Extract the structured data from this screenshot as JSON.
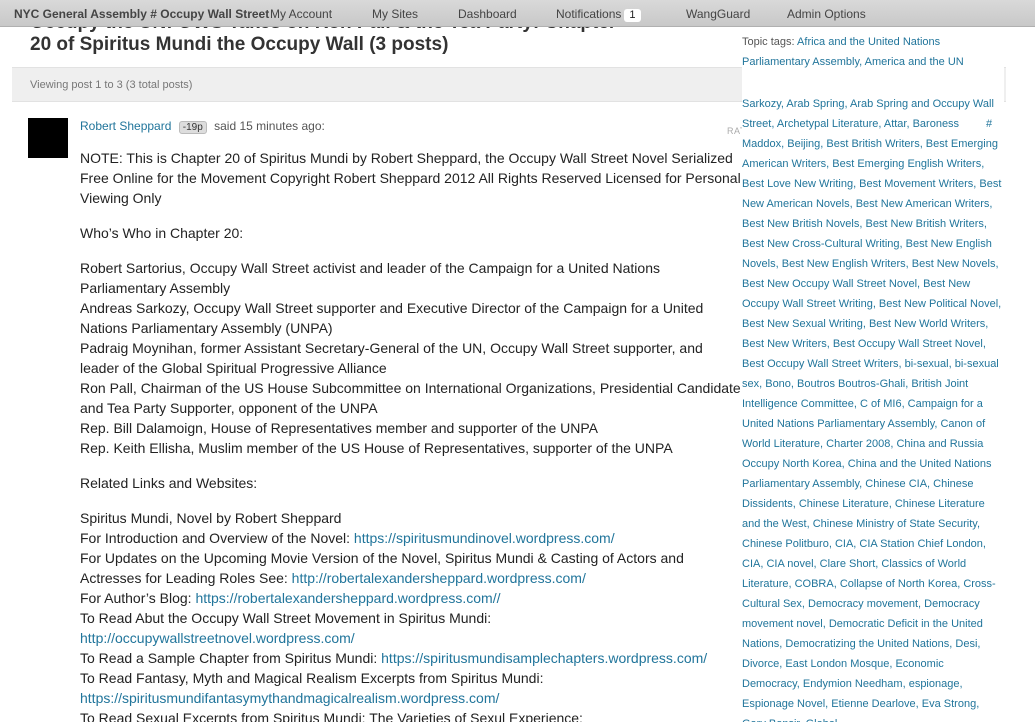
{
  "adminbar": {
    "site": "NYC General Assembly # Occupy Wall Street",
    "my_account": "My Account",
    "my_sites": "My Sites",
    "dashboard": "Dashboard",
    "notifications": "Notifications",
    "notifications_count": "1",
    "wangguard": "WangGuard",
    "admin_options": "Admin Options"
  },
  "topic": {
    "title_line1": "Occupy the UN: OWS Takes on Ron Pall & the Tea Party: Chapter",
    "title_line2": "20 of Spiritus Mundi the Occupy Wall (3 posts)",
    "viewing": "Viewing post 1 to 3 (3 total posts)"
  },
  "post": {
    "author": "Robert Sheppard",
    "karma": "-19p",
    "time": "said 15 minutes ago:",
    "rate_label": "RATE THIS POST",
    "note": "NOTE: This is Chapter 20 of Spiritus Mundi by Robert Sheppard, the Occupy Wall Street Novel Serialized Free Online for the Movement Copyright Robert Sheppard 2012 All Rights Reserved Licensed for Personal Viewing Only",
    "whos_who": "Who’s Who in Chapter 20:",
    "characters": [
      "Robert Sartorius, Occupy Wall Street activist and leader of the Campaign for a United Nations Parliamentary Assembly",
      "Andreas Sarkozy, Occupy Wall Street supporter and Executive Director of the Campaign for a United Nations Parliamentary Assembly (UNPA)",
      "Padraig Moynihan, former Assistant Secretary-General of the UN, Occupy Wall Street supporter, and leader of the Global Spiritual Progressive Alliance",
      "Ron Pall, Chairman of the US House Subcommittee on International Organizations, Presidential Candidate and Tea Party Supporter, opponent of the UNPA",
      "Rep. Bill Dalamoign, House of Representatives member and supporter of the UNPA",
      "Rep. Keith Ellisha, Muslim member of the US House of Representatives, supporter of the UNPA"
    ],
    "related": "Related Links and Websites:",
    "novel_line": "Spiritus Mundi, Novel by Robert Sheppard",
    "intro_text": "For Introduction and Overview of the Novel: ",
    "intro_link": "https://spiritusmundinovel.wordpress.com/",
    "movie_text": "For Updates on the Upcoming Movie Version of the Novel, Spiritus Mundi & Casting of Actors and Actresses for Leading Roles See: ",
    "movie_link": "http://robertalexandersheppard.wordpress.com/",
    "blog_text": "For Author’s Blog: ",
    "blog_link": "https://robertalexandersheppard.wordpress.com//",
    "ows_text": "To Read Abut the Occupy Wall Street Movement in Spiritus Mundi:",
    "ows_link": "http://occupywallstreetnovel.wordpress.com/",
    "sample_text": "To Read a Sample Chapter from Spiritus Mundi: ",
    "sample_link": "https://spiritusmundisamplechapters.wordpress.com/",
    "fantasy_text": "To Read Fantasy, Myth and Magical Realism Excerpts from Spiritus Mundi:",
    "fantasy_link": "https://spiritusmundifantasymythandmagicalrealism.wordpress.com/",
    "sexual_text": "To Read Sexual Excerpts from Spiritus Mundi: The Varieties of Sexul Experience:"
  },
  "sidebar": {
    "topic_tags_label": "Topic tags:",
    "tags_top": "Africa and the United Nations Parliamentary Assembly, America and the UN",
    "tags_main": "Sarkozy, Arab Spring, Arab Spring and Occupy Wall Street, Archetypal Literature, Attar, Baroness Maddox, Beijing, Best British Writers, Best Emerging American Writers, Best Emerging English Writers, Best Love New Writing, Best Movement Writers, Best New American Novels, Best New American Writers, Best New British Novels, Best New British Writers, Best New Cross-Cultural Writing, Best New English Novels, Best New English Writers, Best New Novels, Best New Occupy Wall Street Novel, Best New Occupy Wall Street Writing, Best New Political Novel, Best New Sexual Writing, Best New World Writers, Best New Writers, Best Occupy Wall Street Novel, Best Occupy Wall Street Writers, bi-sexual, bi-sexual sex, Bono, Boutros Boutros-Ghali, British Joint Intelligence Committee, C of MI6, Campaign for a United Nations Parliamentary Assembly, Canon of World Literature, Charter 2008, China and Russia Occupy North Korea, China and the United Nations Parliamentary Assembly, Chinese CIA, Chinese Dissidents, Chinese Literature, Chinese Literature and the West, Chinese Ministry of State Security, Chinese Politburo, CIA, CIA Station Chief London, CIA, CIA novel, Clare Short, Classics of World Literature, COBRA, Collapse of North Korea, Cross-Cultural Sex, Democracy movement, Democracy movement novel, Democratic Deficit in the United Nations, Democratizing the United Nations, Desi, Divorce, East London Mosque, Economic Democracy, Endymion Needham, espionage, Espionage Novel, Etienne Dearlove, Eva Strong, Gary Bonsir, Global"
  }
}
